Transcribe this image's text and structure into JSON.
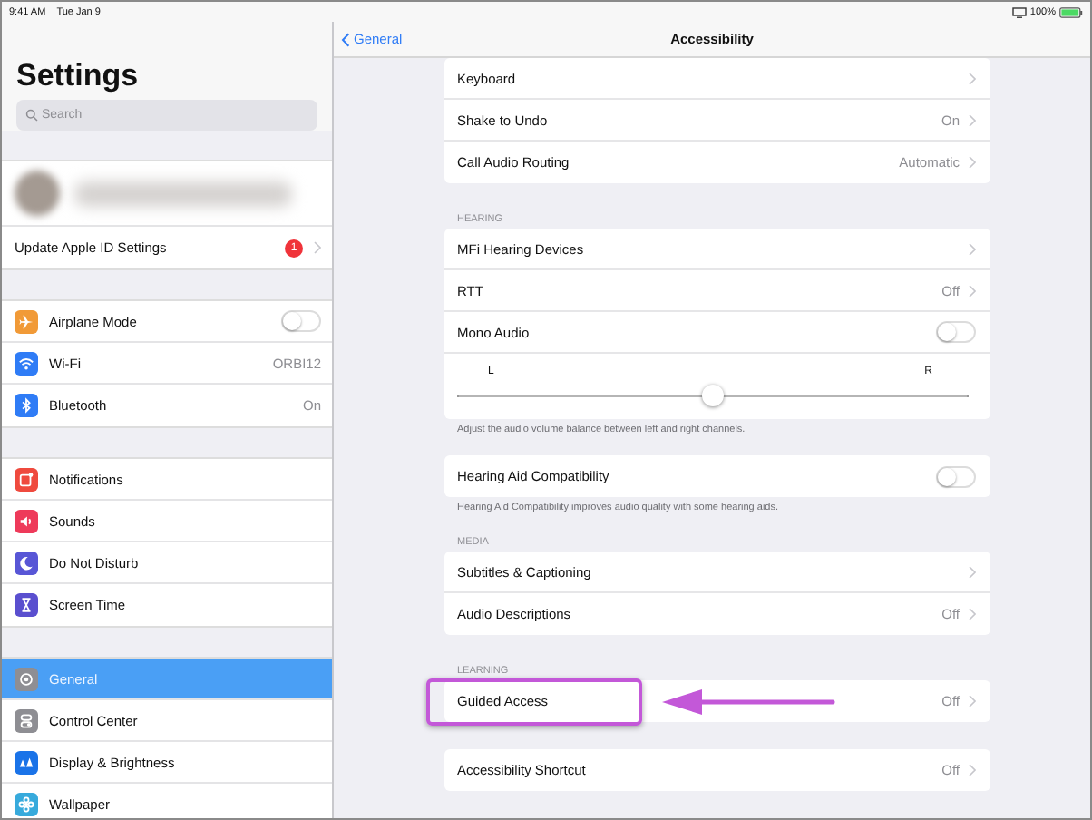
{
  "status_bar": {
    "time": "9:41 AM",
    "date": "Tue Jan 9",
    "battery": "100%"
  },
  "sidebar": {
    "title": "Settings",
    "search": {
      "placeholder": "Search"
    },
    "groups": [
      {
        "items": [
          {
            "kind": "profile",
            "selected": false
          },
          {
            "kind": "account",
            "label": "Update Apple ID Settings",
            "badge": "1",
            "chevron": true,
            "selected": false
          }
        ]
      },
      {
        "items": [
          {
            "kind": "airplane",
            "label": "Airplane Mode",
            "color": "#f19a37",
            "on": false,
            "selected": false
          },
          {
            "kind": "wifi",
            "label": "Wi-Fi",
            "color": "#2f7cf6",
            "value": "ORBI12",
            "selected": false
          },
          {
            "kind": "bluetooth",
            "label": "Bluetooth",
            "color": "#2f7cf6",
            "value": "On",
            "selected": false
          }
        ]
      },
      {
        "items": [
          {
            "kind": "notifications",
            "label": "Notifications",
            "color": "#ef4a3e",
            "selected": false
          },
          {
            "kind": "sounds",
            "label": "Sounds",
            "color": "#ee3a5a",
            "selected": false
          },
          {
            "kind": "moon",
            "label": "Do Not Disturb",
            "color": "#5856d6",
            "selected": false
          },
          {
            "kind": "hourglass",
            "label": "Screen Time",
            "color": "#5a4fcf",
            "selected": false
          }
        ]
      },
      {
        "items": [
          {
            "kind": "gear",
            "label": "General",
            "color": "#8e8e93",
            "selected": true
          },
          {
            "kind": "switches",
            "label": "Control Center",
            "color": "#8e8e93",
            "selected": false
          },
          {
            "kind": "display",
            "label": "Display & Brightness",
            "color": "#1a73e8",
            "selected": false
          },
          {
            "kind": "flower",
            "label": "Wallpaper",
            "color": "#37aadc",
            "selected": false
          }
        ]
      }
    ]
  },
  "detail": {
    "nav": {
      "back": "General",
      "title": "Accessibility"
    },
    "sections": [
      {
        "rows": [
          {
            "kind": "chevron",
            "label": "Keyboard",
            "highlighted": false
          },
          {
            "kind": "chevron",
            "label": "Shake to Undo",
            "value": "On",
            "highlighted": false
          },
          {
            "kind": "chevron",
            "label": "Call Audio Routing",
            "value": "Automatic",
            "highlighted": false
          }
        ]
      },
      {
        "header": "HEARING",
        "footer": "Adjust the audio volume balance between left and right channels.",
        "rows": [
          {
            "kind": "chevron",
            "label": "MFi Hearing Devices",
            "highlighted": false
          },
          {
            "kind": "chevron",
            "label": "RTT",
            "value": "Off",
            "highlighted": false
          },
          {
            "kind": "toggle",
            "label": "Mono Audio",
            "on": false,
            "highlighted": false
          },
          {
            "kind": "slider",
            "min_label": "L",
            "max_label": "R",
            "level": 0.5,
            "highlighted": false
          }
        ]
      },
      {
        "footer": "Hearing Aid Compatibility improves audio quality with some hearing aids.",
        "rows": [
          {
            "kind": "toggle",
            "label": "Hearing Aid Compatibility",
            "on": false,
            "highlighted": false
          }
        ]
      },
      {
        "header": "MEDIA",
        "rows": [
          {
            "kind": "chevron",
            "label": "Subtitles & Captioning",
            "highlighted": false
          },
          {
            "kind": "chevron",
            "label": "Audio Descriptions",
            "value": "Off",
            "highlighted": false
          }
        ]
      },
      {
        "header": "LEARNING",
        "rows": [
          {
            "kind": "chevron",
            "label": "Guided Access",
            "value": "Off",
            "highlighted": true
          }
        ]
      },
      {
        "rows": [
          {
            "kind": "chevron",
            "label": "Accessibility Shortcut",
            "value": "Off",
            "highlighted": false
          }
        ]
      }
    ]
  }
}
